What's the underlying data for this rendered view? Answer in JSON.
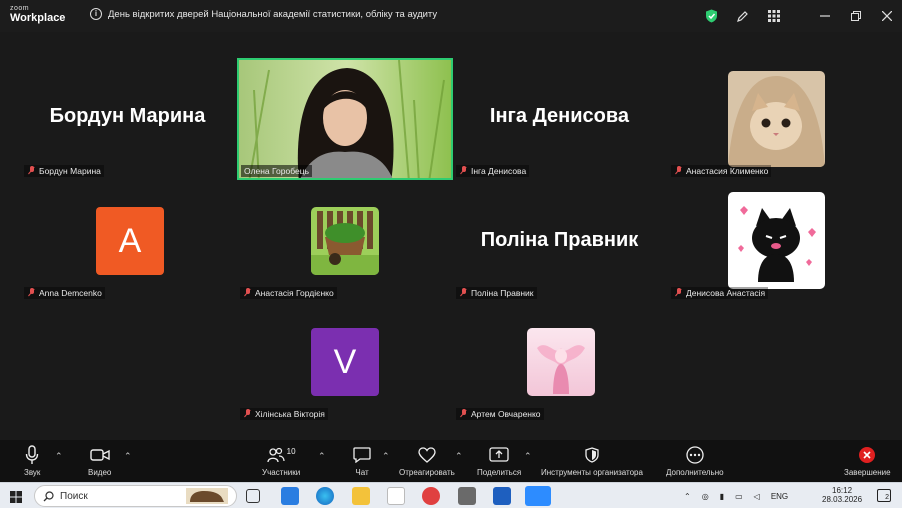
{
  "app": {
    "logo_small": "zoom",
    "logo_big": "Workplace"
  },
  "meeting_title": "День відкритих дверей Національної академії статистики, обліку та аудиту",
  "tiles": {
    "bordun": {
      "big": "Бордун Марина",
      "tag": "Бордун Марина"
    },
    "olena": {
      "tag": "Олена Горобець"
    },
    "inga": {
      "big": "Інга Денисова",
      "tag": "Інга Денисова"
    },
    "klymenko": {
      "tag": "Анастасия Клименко"
    },
    "anna": {
      "letter": "A",
      "tag": "Anna Demcenko",
      "color": "#f05a24"
    },
    "gordienko": {
      "tag": "Анастасія Гордієнко"
    },
    "polina": {
      "big": "Поліна Правник",
      "tag": "Поліна Правник"
    },
    "denysova": {
      "tag": "Денисова Анастасія"
    },
    "khilinska": {
      "letter": "V",
      "tag": "Хілінська Вікторія",
      "color": "#7b2fb0"
    },
    "ovcharenko": {
      "tag": "Артем Овчаренко"
    }
  },
  "toolbar": {
    "audio": "Звук",
    "video": "Видео",
    "participants": "Участники",
    "participants_count": "10",
    "chat": "Чат",
    "react": "Отреагировать",
    "share": "Поделиться",
    "host_tools": "Инструменты организатора",
    "more": "Дополнительно",
    "end": "Завершение"
  },
  "taskbar": {
    "search_placeholder": "Поиск",
    "lang": "ENG",
    "time": "16:12",
    "date": "28.03.2026",
    "notifications": "2"
  },
  "colors": {
    "accent_green": "#2ecc71",
    "end_red": "#e02020"
  }
}
